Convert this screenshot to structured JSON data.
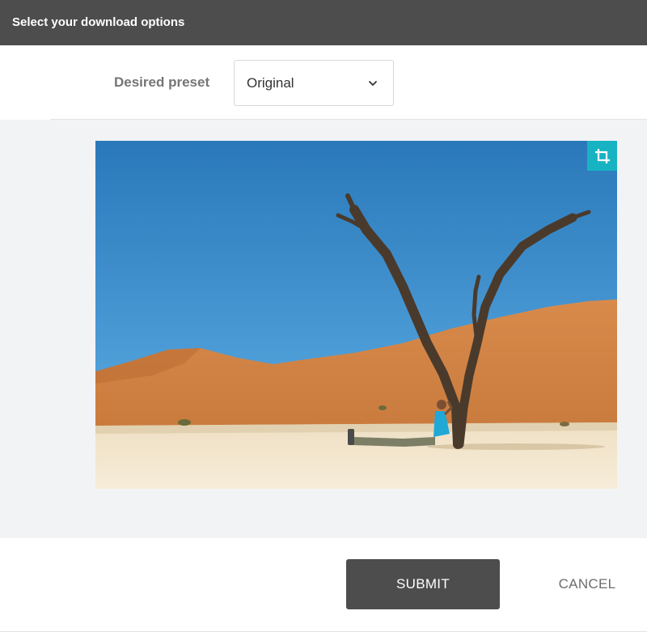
{
  "dialog": {
    "title": "Select your download options"
  },
  "preset": {
    "label": "Desired preset",
    "selected": "Original",
    "icon": "chevron-down-icon"
  },
  "preview": {
    "crop_icon": "crop-icon",
    "crop_button_color": "#17b3c3"
  },
  "actions": {
    "submit_label": "SUBMIT",
    "cancel_label": "CANCEL"
  },
  "colors": {
    "header": "#4d4d4d",
    "preview_background": "#f2f3f5",
    "submit": "#4d4d4d"
  }
}
